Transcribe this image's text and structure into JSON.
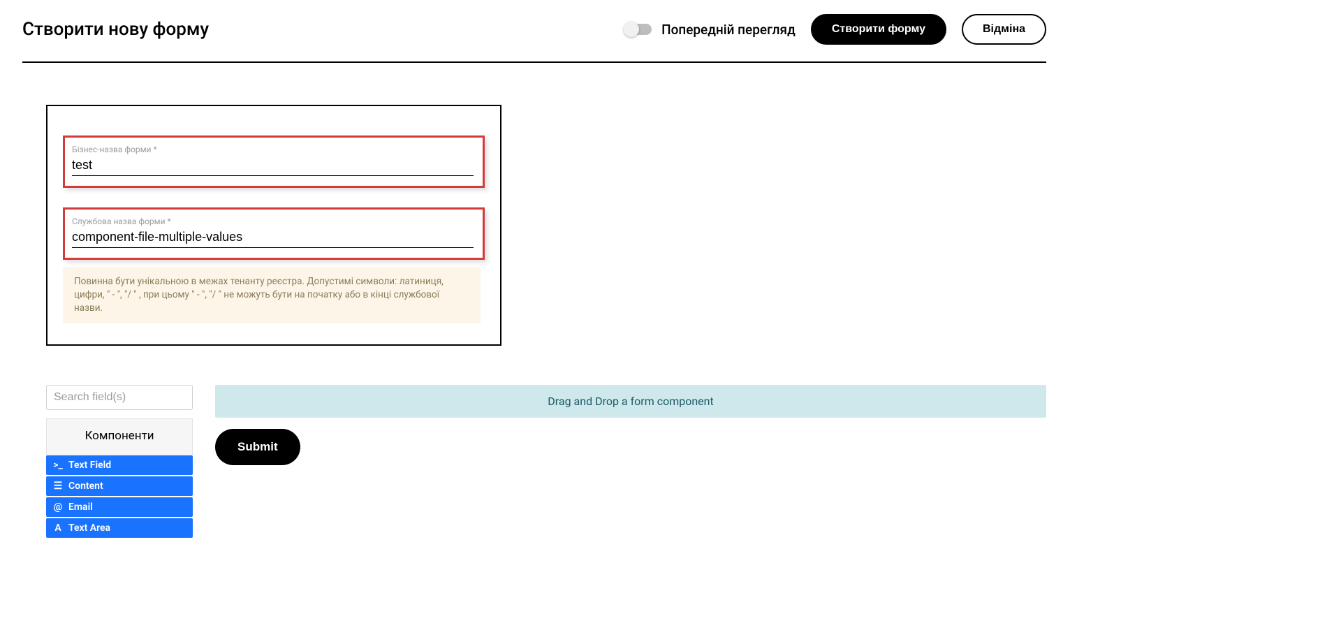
{
  "header": {
    "title": "Створити нову форму",
    "preview_label": "Попередній перегляд",
    "create_label": "Створити форму",
    "cancel_label": "Відміна"
  },
  "config": {
    "business_name_label": "Бізнес-назва форми *",
    "business_name_value": "test",
    "service_name_label": "Службова назва форми *",
    "service_name_value": "component-file-multiple-values",
    "hint": "Повинна бути унікальною в межах тенанту реєстра. Допустимі символи: латиниця, цифри, \" - \", \"/ \" , при цьому  \" - \", \"/ \" не можуть бути на початку або в кінці службової назви."
  },
  "sidebar": {
    "search_placeholder": "Search field(s)",
    "components_header": "Компоненти",
    "items": [
      {
        "icon": ">_",
        "label": "Text Field"
      },
      {
        "icon": "☰",
        "label": "Content"
      },
      {
        "icon": "@",
        "label": "Email"
      },
      {
        "icon": "A",
        "label": "Text Area"
      }
    ]
  },
  "canvas": {
    "dropzone_label": "Drag and Drop a form component",
    "submit_label": "Submit"
  }
}
